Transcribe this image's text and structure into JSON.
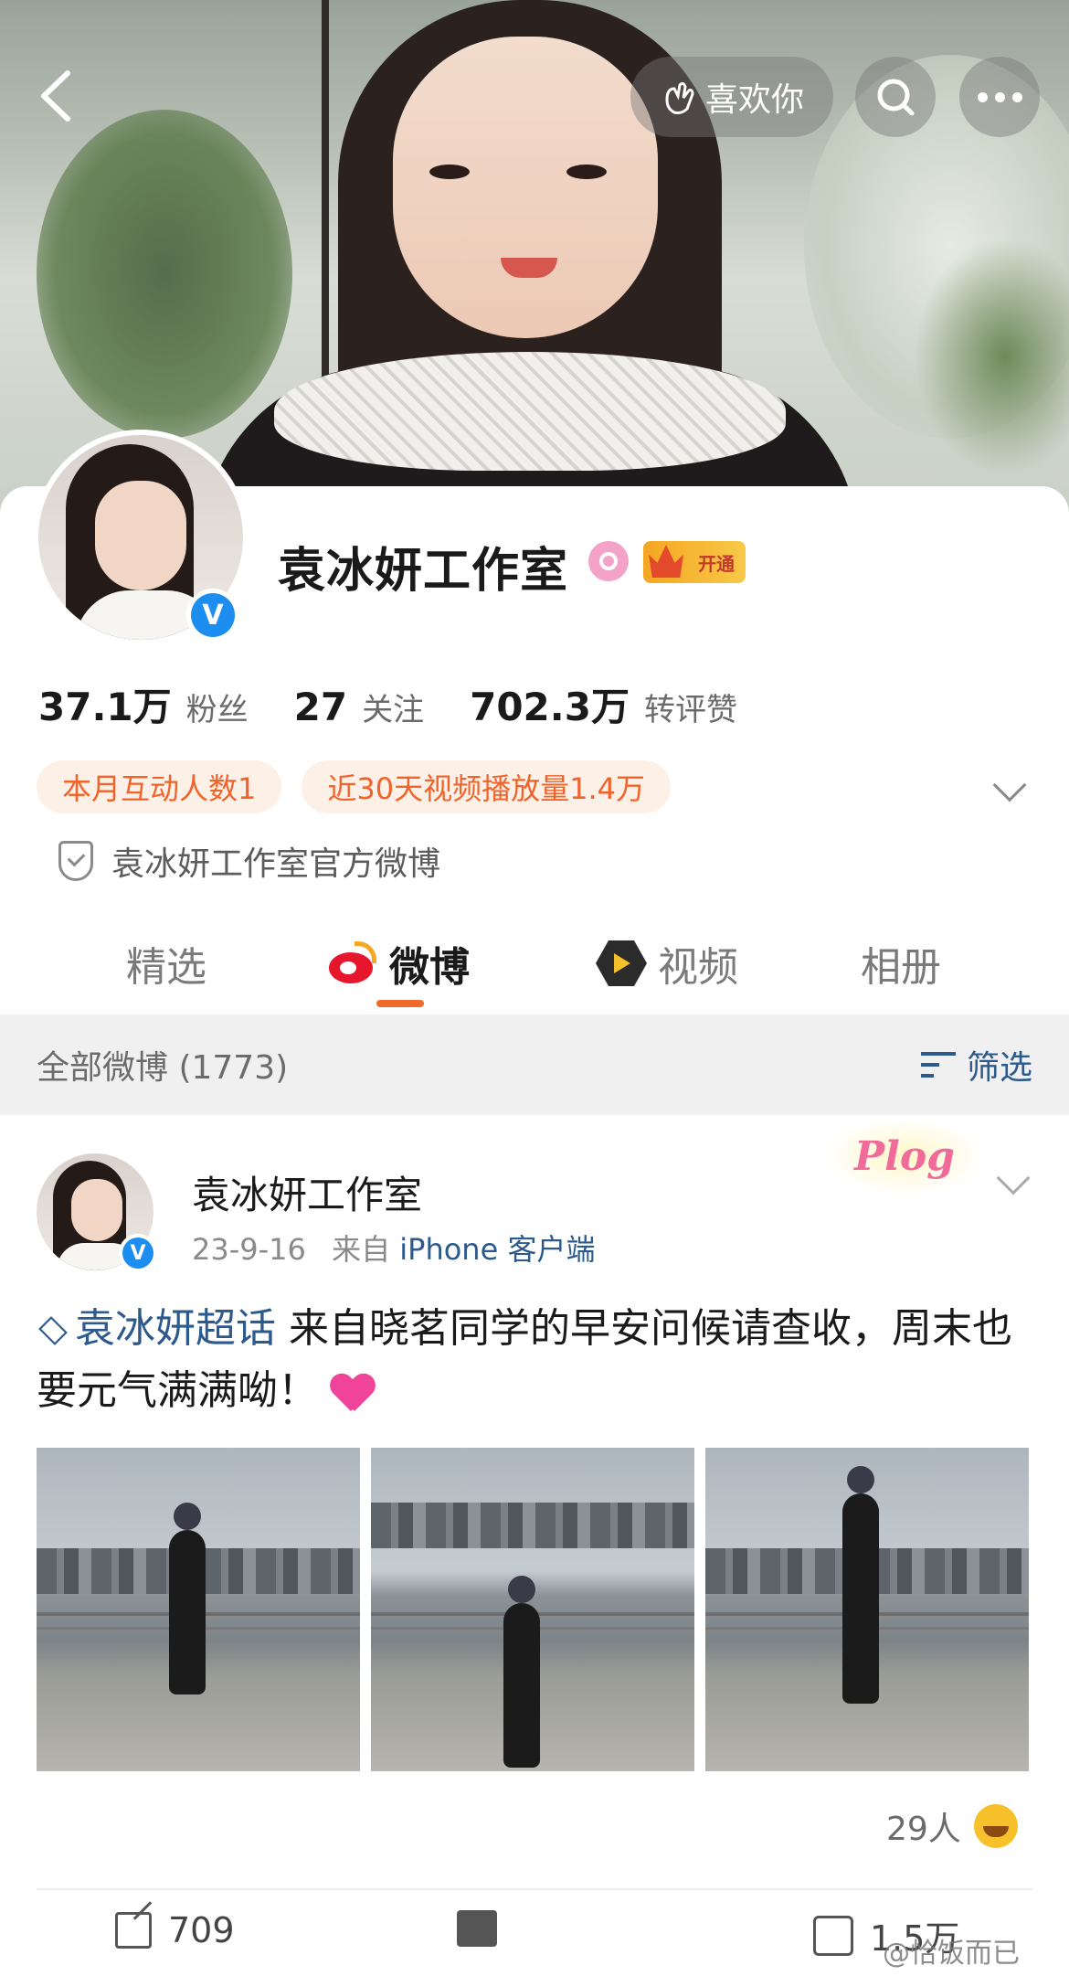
{
  "header": {
    "like_label": "喜欢你",
    "icons": {
      "back": "chevron-left-icon",
      "like": "hand-heart-icon",
      "search": "search-icon",
      "more": "more-dots-icon"
    }
  },
  "profile": {
    "name": "袁冰妍工作室",
    "vip_label": "开通",
    "stats": [
      {
        "value": "37.1万",
        "label": "粉丝"
      },
      {
        "value": "27",
        "label": "关注"
      },
      {
        "value": "702.3万",
        "label": "转评赞"
      }
    ],
    "chips": [
      "本月互动人数1",
      "近30天视频播放量1.4万"
    ],
    "official": "袁冰妍工作室官方微博",
    "accent_color": "#f06a2b",
    "verified_color": "#1e8df0"
  },
  "tabs": [
    "精选",
    "微博",
    "视频",
    "相册"
  ],
  "active_tab": "微博",
  "filter_bar": {
    "all_label": "全部微博 (1773)",
    "filter_label": "筛选"
  },
  "post": {
    "author": "袁冰妍工作室",
    "date": "23-9-16",
    "from": "来自",
    "source": "iPhone 客户端",
    "badge": "Plog",
    "topic": "袁冰妍超话",
    "text": " 来自晓茗同学的早安问候请查收，周末也要元气满满呦！",
    "reaction_count": "29人",
    "share_count": "709",
    "like_count": "1.5万"
  },
  "watermark": "@恰饭而已"
}
